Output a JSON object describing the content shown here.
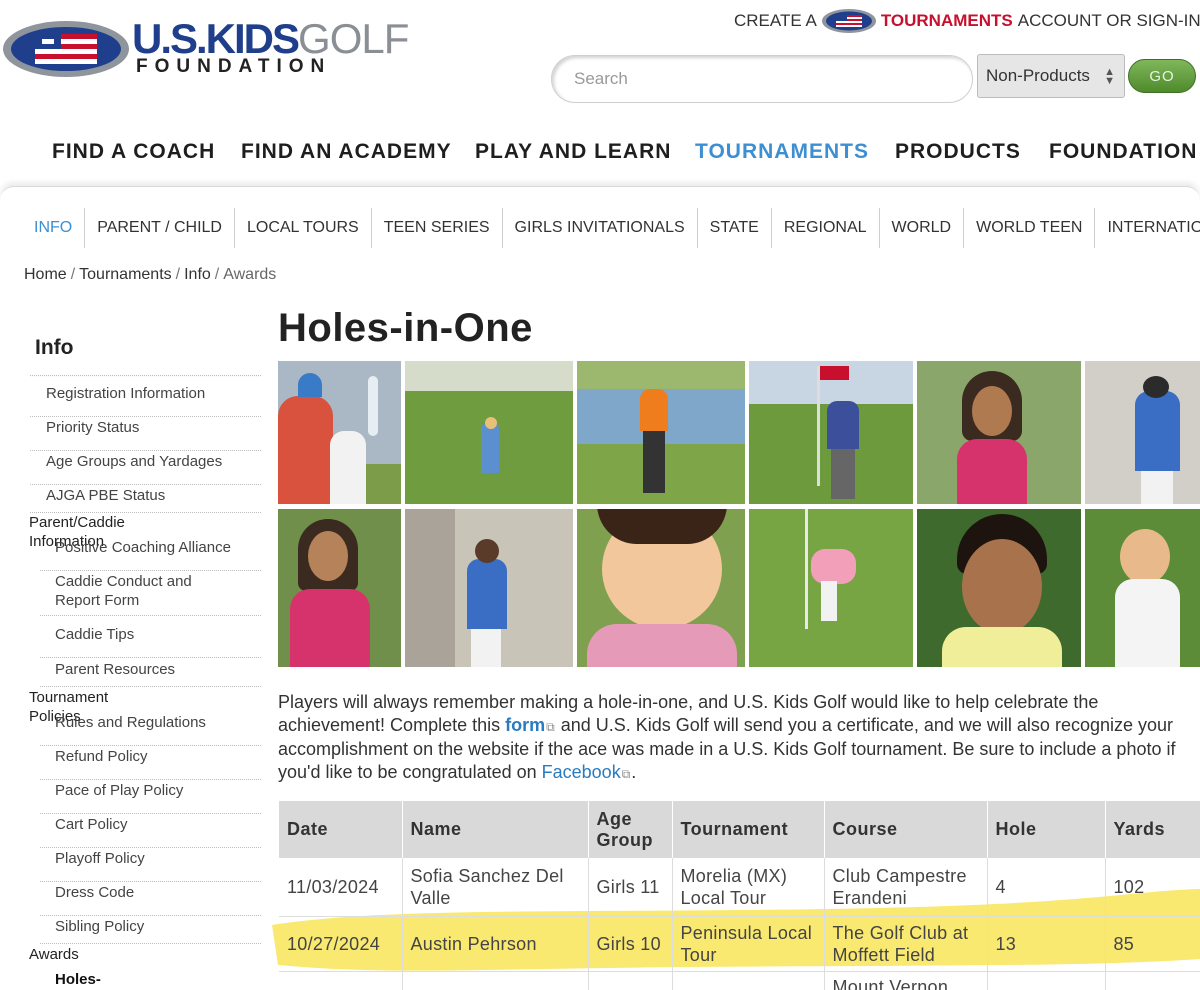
{
  "brand": {
    "logo_main": "U.S.KIDS",
    "logo_golf": "GOLF",
    "logo_sub": "FOUNDATION"
  },
  "account": {
    "prefix": "CREATE A",
    "tournaments": "TOURNAMENTS",
    "suffix": "ACCOUNT OR SIGN-IN"
  },
  "search": {
    "placeholder": "Search",
    "select_value": "Non-Products",
    "go_label": "GO"
  },
  "main_nav": [
    {
      "label": "FIND A COACH"
    },
    {
      "label": "FIND AN ACADEMY"
    },
    {
      "label": "PLAY AND LEARN"
    },
    {
      "label": "TOURNAMENTS",
      "active": true
    },
    {
      "label": "PRODUCTS"
    },
    {
      "label": "FOUNDATION"
    }
  ],
  "sub_nav": [
    {
      "label": "INFO",
      "active": true
    },
    {
      "label": "PARENT / CHILD"
    },
    {
      "label": "LOCAL TOURS"
    },
    {
      "label": "TEEN SERIES"
    },
    {
      "label": "GIRLS INVITATIONALS"
    },
    {
      "label": "STATE"
    },
    {
      "label": "REGIONAL"
    },
    {
      "label": "WORLD"
    },
    {
      "label": "WORLD TEEN"
    },
    {
      "label": "INTERNATIONAL"
    }
  ],
  "breadcrumb": {
    "home": "Home",
    "tournaments": "Tournaments",
    "info": "Info",
    "current": "Awards"
  },
  "sidebar": {
    "title": "Info",
    "items": [
      {
        "label": "Registration Information"
      },
      {
        "label": "Priority Status"
      },
      {
        "label": "Age Groups and Yardages"
      },
      {
        "label": "AJGA PBE Status"
      },
      {
        "label": "Parent/Caddie Information"
      },
      {
        "label": "Positive Coaching Alliance"
      },
      {
        "label": "Caddie Conduct and Report Form"
      },
      {
        "label": "Caddie Tips"
      },
      {
        "label": "Parent Resources"
      },
      {
        "label": "Tournament Policies"
      },
      {
        "label": "Rules and Regulations"
      },
      {
        "label": "Refund Policy"
      },
      {
        "label": "Pace of Play Policy"
      },
      {
        "label": "Cart Policy"
      },
      {
        "label": "Playoff Policy"
      },
      {
        "label": "Dress Code"
      },
      {
        "label": "Sibling Policy"
      },
      {
        "label": "Awards"
      },
      {
        "label": "Holes-in-One"
      }
    ]
  },
  "page": {
    "title": "Holes-in-One",
    "intro_1": "Players will always remember making a hole-in-one, and U.S. Kids Golf would like to help celebrate the achievement! Complete this",
    "form_link": "form",
    "intro_2": "and U.S. Kids Golf will send you a certificate, and we will also recognize your accomplishment on the website if the ace was made in a U.S. Kids Golf tournament. Be sure to include a photo if you'd like to be congratulated on",
    "facebook_link": "Facebook",
    "intro_end": "."
  },
  "table": {
    "headers": [
      "Date",
      "Name",
      "Age Group",
      "Tournament",
      "Course",
      "Hole",
      "Yards"
    ],
    "rows": [
      [
        "11/03/2024",
        "Sofia Sanchez Del Valle",
        "Girls 11",
        "Morelia (MX) Local Tour",
        "Club Campestre Erandeni",
        "4",
        "102"
      ],
      [
        "10/27/2024",
        "Austin Pehrson",
        "Girls 10",
        "Peninsula Local Tour",
        "The Golf Club at Moffett Field",
        "13",
        "85"
      ],
      [
        "",
        "",
        "",
        "",
        "Mount Vernon",
        "",
        ""
      ]
    ]
  },
  "colors": {
    "accent_blue": "#3d8fd1",
    "brand_navy": "#1f3f8c",
    "brand_red": "#c8102e",
    "go_green": "#5a9a35",
    "highlight_yellow": "#f7e03a"
  }
}
